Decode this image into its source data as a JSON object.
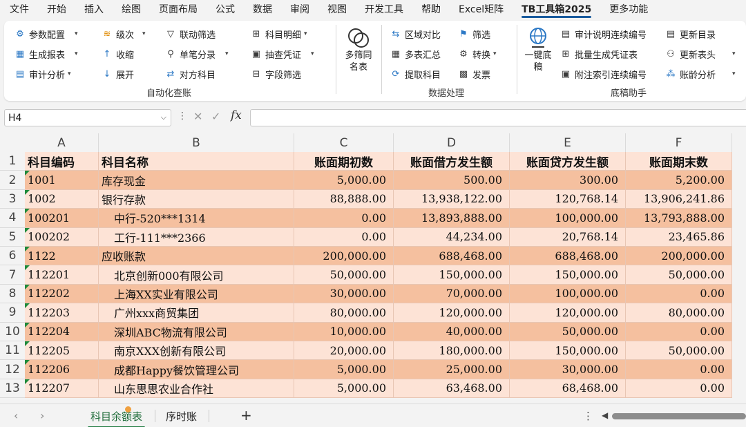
{
  "menu": [
    "文件",
    "开始",
    "插入",
    "绘图",
    "页面布局",
    "公式",
    "数据",
    "审阅",
    "视图",
    "开发工具",
    "帮助",
    "Excel矩阵",
    "TB工具箱2025",
    "更多功能"
  ],
  "menu_active_index": 12,
  "ribbon": {
    "group1": {
      "label": "自动化查账",
      "col1": [
        {
          "label": "参数配置",
          "icon": "settings-icon",
          "dropdown": true
        },
        {
          "label": "生成报表",
          "icon": "report-icon",
          "dropdown": true
        },
        {
          "label": "审计分析",
          "icon": "audit-icon",
          "dropdown": true
        }
      ],
      "col2": [
        {
          "label": "级次",
          "icon": "stack-icon",
          "dropdown": true
        },
        {
          "label": "收缩",
          "icon": "collapse-arrow-icon",
          "dropdown": false
        },
        {
          "label": "展开",
          "icon": "expand-arrow-icon",
          "dropdown": false
        }
      ],
      "col3": [
        {
          "label": "联动筛选",
          "icon": "filter-icon",
          "dropdown": false
        },
        {
          "label": "单笔分录",
          "icon": "search-icon",
          "dropdown": true
        },
        {
          "label": "对方科目",
          "icon": "counter-account-icon",
          "dropdown": false
        }
      ],
      "col4": [
        {
          "label": "科目明细",
          "icon": "detail-icon",
          "dropdown": true
        },
        {
          "label": "抽查凭证",
          "icon": "voucher-icon",
          "dropdown": true
        },
        {
          "label": "字段筛选",
          "icon": "field-filter-icon",
          "dropdown": false
        }
      ]
    },
    "big_button_multi": "多筛同名表",
    "group2": {
      "label": "数据处理",
      "col1": [
        {
          "label": "区域对比",
          "icon": "compare-icon"
        },
        {
          "label": "多表汇总",
          "icon": "merge-icon"
        },
        {
          "label": "提取科目",
          "icon": "extract-icon"
        }
      ],
      "col2": [
        {
          "label": "筛选",
          "icon": "funnel-icon",
          "dropdown": false
        },
        {
          "label": "转换",
          "icon": "convert-icon",
          "dropdown": true
        },
        {
          "label": "发票",
          "icon": "invoice-icon",
          "dropdown": false
        }
      ]
    },
    "big_button_onekey": "一键底稿",
    "group3": {
      "label": "底稿助手",
      "col1": [
        {
          "label": "审计说明连续编号",
          "icon": "numbering-icon"
        },
        {
          "label": "批量生成凭证表",
          "icon": "batch-icon"
        },
        {
          "label": "附注索引连续编号",
          "icon": "index-icon"
        }
      ],
      "col2": [
        {
          "label": "更新目录",
          "icon": "toc-icon",
          "dropdown": false
        },
        {
          "label": "更新表头",
          "icon": "header-icon",
          "dropdown": true
        },
        {
          "label": "账龄分析",
          "icon": "aging-icon",
          "dropdown": true
        }
      ]
    }
  },
  "formula_bar": {
    "name_box": "H4",
    "cancel_icon": "✕",
    "confirm_icon": "✓",
    "fx": "fx",
    "value": ""
  },
  "columns": [
    "A",
    "B",
    "C",
    "D",
    "E",
    "F"
  ],
  "row_numbers": [
    "1",
    "2",
    "3",
    "4",
    "5",
    "6",
    "7",
    "8",
    "9",
    "10",
    "11",
    "12",
    "13"
  ],
  "table_header": [
    "科目编码",
    "科目名称",
    "账面期初数",
    "账面借方发生额",
    "账面贷方发生额",
    "账面期末数"
  ],
  "rows": [
    {
      "code": "1001",
      "name": "库存现金",
      "opening": "5,000.00",
      "debit": "500.00",
      "credit": "300.00",
      "closing": "5,200.00",
      "indent": false,
      "shade": "dark"
    },
    {
      "code": "1002",
      "name": "银行存款",
      "opening": "88,888.00",
      "debit": "13,938,122.00",
      "credit": "120,768.14",
      "closing": "13,906,241.86",
      "indent": false,
      "shade": "light"
    },
    {
      "code": "100201",
      "name": "中行-520***1314",
      "opening": "0.00",
      "debit": "13,893,888.00",
      "credit": "100,000.00",
      "closing": "13,793,888.00",
      "indent": true,
      "shade": "dark"
    },
    {
      "code": "100202",
      "name": "工行-111***2366",
      "opening": "0.00",
      "debit": "44,234.00",
      "credit": "20,768.14",
      "closing": "23,465.86",
      "indent": true,
      "shade": "light"
    },
    {
      "code": "1122",
      "name": "应收账款",
      "opening": "200,000.00",
      "debit": "688,468.00",
      "credit": "688,468.00",
      "closing": "200,000.00",
      "indent": false,
      "shade": "dark"
    },
    {
      "code": "112201",
      "name": "北京创新000有限公司",
      "opening": "50,000.00",
      "debit": "150,000.00",
      "credit": "150,000.00",
      "closing": "50,000.00",
      "indent": true,
      "shade": "light"
    },
    {
      "code": "112202",
      "name": "上海XX实业有限公司",
      "opening": "30,000.00",
      "debit": "70,000.00",
      "credit": "100,000.00",
      "closing": "0.00",
      "indent": true,
      "shade": "dark"
    },
    {
      "code": "112203",
      "name": "广州xxx商贸集团",
      "opening": "80,000.00",
      "debit": "120,000.00",
      "credit": "120,000.00",
      "closing": "80,000.00",
      "indent": true,
      "shade": "light"
    },
    {
      "code": "112204",
      "name": "深圳ABC物流有限公司",
      "opening": "10,000.00",
      "debit": "40,000.00",
      "credit": "50,000.00",
      "closing": "0.00",
      "indent": true,
      "shade": "dark"
    },
    {
      "code": "112205",
      "name": "南京XXX创新有限公司",
      "opening": "20,000.00",
      "debit": "180,000.00",
      "credit": "150,000.00",
      "closing": "50,000.00",
      "indent": true,
      "shade": "light"
    },
    {
      "code": "112206",
      "name": "成都Happy餐饮管理公司",
      "opening": "5,000.00",
      "debit": "25,000.00",
      "credit": "30,000.00",
      "closing": "0.00",
      "indent": true,
      "shade": "dark"
    },
    {
      "code": "112207",
      "name": "山东思思农业合作社",
      "opening": "5,000.00",
      "debit": "63,468.00",
      "credit": "68,468.00",
      "closing": "0.00",
      "indent": true,
      "shade": "light"
    }
  ],
  "sheet_tabs": [
    "科目余额表",
    "序时账"
  ],
  "active_sheet_index": 0,
  "colors": {
    "row_light": "#fde3d6",
    "row_dark": "#f5c09f",
    "active_tab": "#1d7a3e",
    "comment_marker": "#1e8a3a"
  }
}
